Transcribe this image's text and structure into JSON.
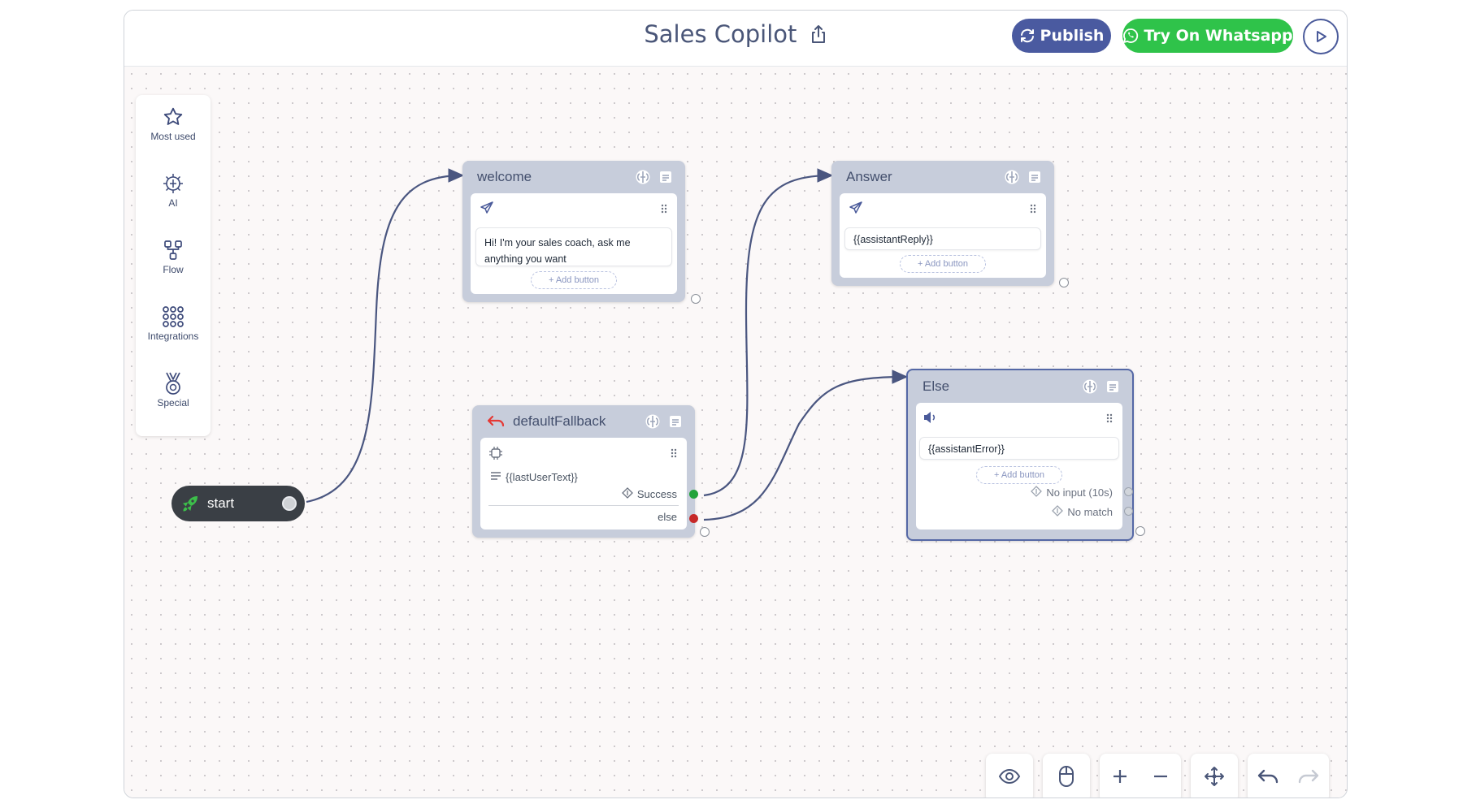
{
  "header": {
    "title": "Sales Copilot",
    "publish_label": "Publish",
    "whatsapp_label": "Try On Whatsapp"
  },
  "palette": {
    "items": [
      {
        "label": "Most used",
        "icon": "star-icon"
      },
      {
        "label": "AI",
        "icon": "ai-brain-icon"
      },
      {
        "label": "Flow",
        "icon": "flow-icon"
      },
      {
        "label": "Integrations",
        "icon": "integrations-icon"
      },
      {
        "label": "Special",
        "icon": "special-icon"
      }
    ]
  },
  "nodes": {
    "start": {
      "label": "start"
    },
    "welcome": {
      "title": "welcome",
      "message": "Hi! I'm your sales coach, ask me anything you want",
      "add_button": "+ Add button"
    },
    "answer": {
      "title": "Answer",
      "message": "{{assistantReply}}",
      "add_button": "+ Add button"
    },
    "fallback": {
      "title": "defaultFallback",
      "text": "{{lastUserText}}",
      "success_label": "Success",
      "else_label": "else"
    },
    "else": {
      "title": "Else",
      "message": "{{assistantError}}",
      "add_button": "+ Add button",
      "no_input_label": "No input (10s)",
      "no_match_label": "No match"
    }
  },
  "colors": {
    "accent": "#4a5aa0",
    "whatsapp": "#2fc34a",
    "success_port": "#22a33a",
    "else_port": "#c62828",
    "wire": "#4a5680"
  }
}
